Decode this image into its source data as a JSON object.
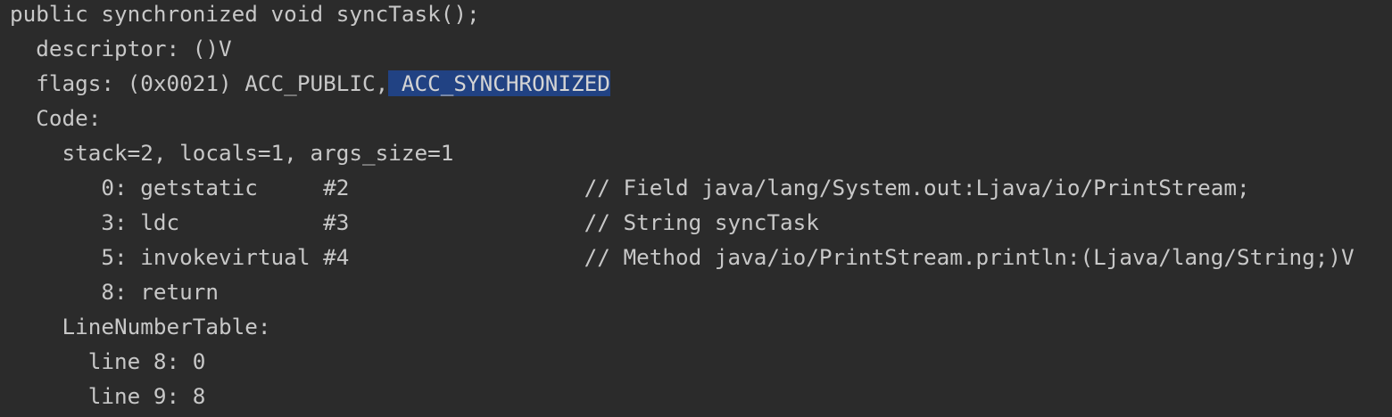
{
  "code": {
    "lines": [
      "public synchronized void syncTask();",
      "  descriptor: ()V",
      "  flags: (0x0021) ACC_PUBLIC,",
      "  Code:",
      "    stack=2, locals=1, args_size=1",
      "       0: getstatic     #2                  // Field java/lang/System.out:Ljava/io/PrintStream;",
      "       3: ldc           #3                  // String syncTask",
      "       5: invokevirtual #4                  // Method java/io/PrintStream.println:(Ljava/lang/String;)V",
      "       8: return",
      "    LineNumberTable:",
      "      line 8: 0",
      "      line 9: 8"
    ],
    "selection": " ACC_SYNCHRONIZED"
  },
  "colors": {
    "background": "#2b2b2b",
    "text": "#c8c8c8",
    "selection": "#214283"
  }
}
